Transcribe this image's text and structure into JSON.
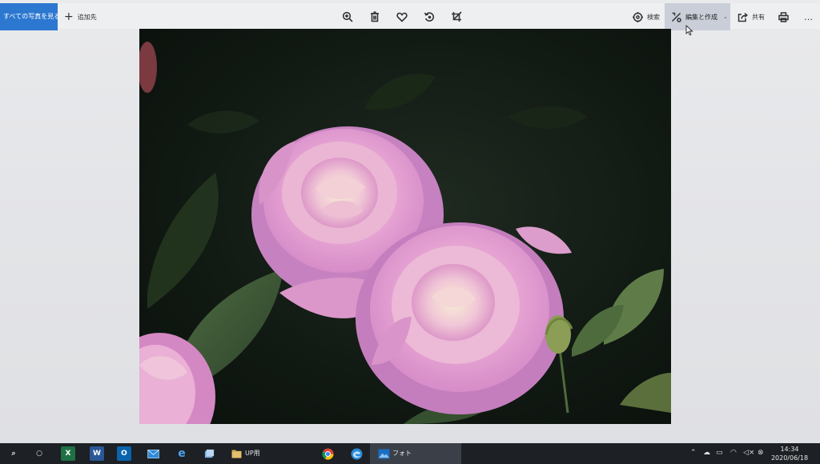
{
  "toolbar": {
    "view_all_label": "すべての写真を見る",
    "add_to_label": "追加先",
    "center_tools": [
      "zoom-icon",
      "delete-icon",
      "favorite-icon",
      "rotate-icon",
      "crop-icon"
    ],
    "search_label": "検索",
    "edit_create_label": "編集と作成",
    "share_label": "共有",
    "more_label": "…",
    "accent_color": "#2c78d0"
  },
  "photo": {
    "subject": "pink roses",
    "colors": {
      "petal": "#e9a3d6",
      "petal_shadow": "#c97fbf",
      "leaf": "#3c5a36",
      "background": "#101810"
    }
  },
  "taskbar": {
    "search_icon": "search-icon",
    "folder_label": "UP用",
    "photos_label": "フォト",
    "clock_time": "14:34",
    "clock_date": "2020/06/18"
  }
}
